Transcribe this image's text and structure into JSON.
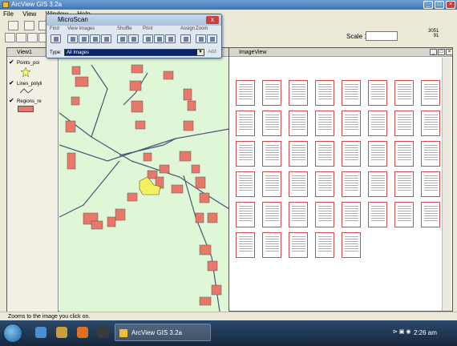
{
  "app": {
    "title": "ArcView GIS 3.2a"
  },
  "menu": [
    "File",
    "View",
    "Window",
    "Help"
  ],
  "toolbar": {
    "scale_label": "Scale 1:",
    "scale_value": "",
    "coords": [
      "3051",
      "91"
    ]
  },
  "view1": {
    "title": "View1",
    "layers": [
      {
        "label": "Points_poi",
        "checked": true
      },
      {
        "label": "Lines_polyli",
        "checked": true
      },
      {
        "label": "Regions_re",
        "checked": true
      }
    ]
  },
  "microscan": {
    "title": "MicroScan",
    "close": "x",
    "groups": [
      "Find",
      "View Images",
      "Shuffle",
      "Print",
      "Assign",
      "Zoom"
    ],
    "type_label": "Type:",
    "type_value": "All Images",
    "add_label": "Add"
  },
  "imageview": {
    "title": "ImageView",
    "thumbnails": 45
  },
  "status": "Zooms to the image you click on.",
  "taskbar": {
    "task_label": "ArcView GIS 3.2a",
    "clock": "2:26 am"
  },
  "colors": {
    "map_bg": "#dff7d6",
    "parcel": "#e8786a",
    "selected": "#f4f060",
    "road": "#4a5574",
    "thumb_border": "#d24a4a"
  }
}
